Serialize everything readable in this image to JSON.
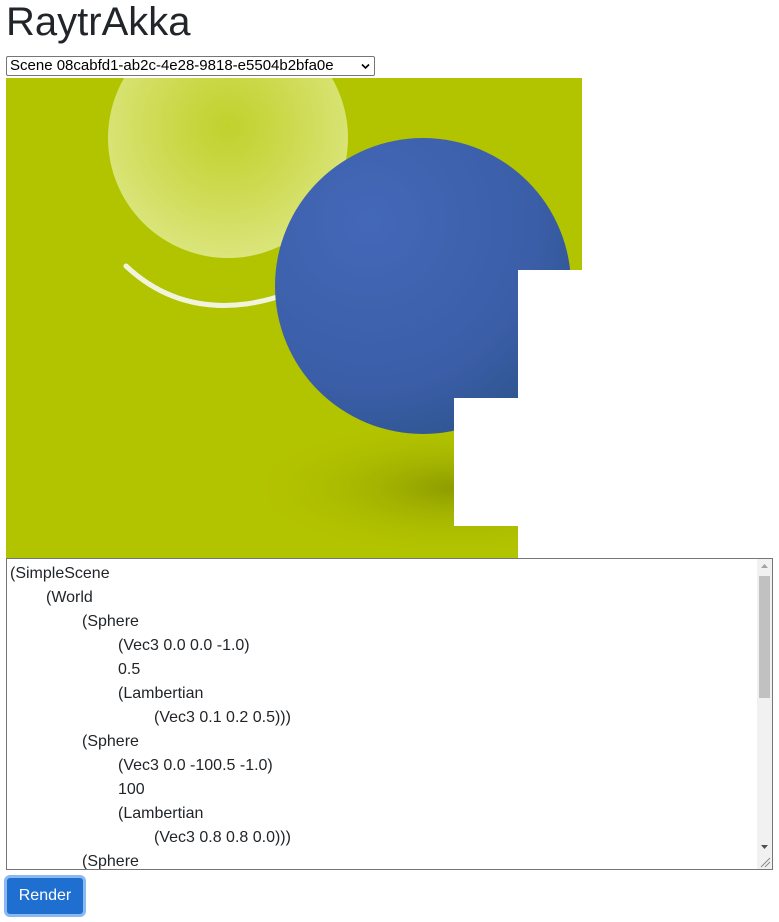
{
  "app": {
    "title": "RaytrAkka"
  },
  "scene_select": {
    "selected": "Scene 08cabfd1-ab2c-4e28-9818-e5504b2bfa0e"
  },
  "icons": {
    "select_arrow": "chevron-down-icon",
    "scroll_up": "triangle-up-icon",
    "scroll_down": "triangle-down-icon"
  },
  "render": {
    "colors": {
      "background": "#b2c300",
      "blue_sphere": "#3c5fb0",
      "unrendered": "#ffffff"
    }
  },
  "scene_text": {
    "lines": [
      {
        "text": "(SimpleScene",
        "indent": 0
      },
      {
        "text": "(World",
        "indent": 1
      },
      {
        "text": "(Sphere",
        "indent": 2
      },
      {
        "text": "(Vec3 0.0 0.0 -1.0)",
        "indent": 3
      },
      {
        "text": "0.5",
        "indent": 3
      },
      {
        "text": "(Lambertian",
        "indent": 3
      },
      {
        "text": "(Vec3 0.1 0.2 0.5)))",
        "indent": 4
      },
      {
        "text": "(Sphere",
        "indent": 2
      },
      {
        "text": "(Vec3 0.0 -100.5 -1.0)",
        "indent": 3
      },
      {
        "text": "100",
        "indent": 3
      },
      {
        "text": "(Lambertian",
        "indent": 3
      },
      {
        "text": "(Vec3 0.8 0.8 0.0)))",
        "indent": 4
      },
      {
        "text": "(Sphere",
        "indent": 2
      }
    ]
  },
  "render_button": {
    "label": "Render",
    "color": "#1f6fd0"
  }
}
